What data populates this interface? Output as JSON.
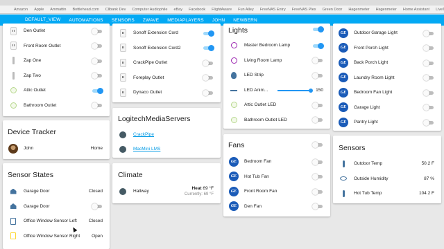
{
  "bookmarks": [
    "Amazon",
    "Apple",
    "Ammattin",
    "Bottlehead.com",
    "Cllbank Dev",
    "Computer Audiophile",
    "eBay",
    "Facebook",
    "FlightAware",
    "Fun Alley",
    "FreeNAS Entry",
    "FreeNAS Plex",
    "Green Door",
    "Hagenmeter",
    "Hagenmeter",
    "Home Assistant",
    "LiveTV Entry"
  ],
  "tabs": [
    "DEFAULT_VIEW",
    "AUTOMATIONS",
    "SENSORS",
    "ZWAVE",
    "MEDIAPLAYERS",
    "JOHN",
    "NEWBERN"
  ],
  "switches_card": {
    "items": [
      {
        "label": "Den Outlet",
        "icon": "outlet-icon",
        "on": false
      },
      {
        "label": "Front Room Outlet",
        "icon": "outlet-icon",
        "on": false
      },
      {
        "label": "Zap One",
        "icon": "plug-icon",
        "on": false
      },
      {
        "label": "Zap Two",
        "icon": "plug-icon",
        "on": false
      },
      {
        "label": "Attic Outlet",
        "icon": "light-icon",
        "on": true
      },
      {
        "label": "Bathroom Outlet",
        "icon": "light-icon",
        "on": false
      }
    ]
  },
  "device_tracker": {
    "title": "Device Tracker",
    "person": "John",
    "state": "Home"
  },
  "sensor_states": {
    "title": "Sensor States",
    "items": [
      {
        "label": "Garage Door",
        "value": "Closed",
        "icon": "garage-icon",
        "toggle": false
      },
      {
        "label": "Garage Door",
        "value": "",
        "icon": "garage-icon",
        "toggle": true
      },
      {
        "label": "Office Window Sensor Left",
        "value": "Closed",
        "icon": "window-icon",
        "toggle": false
      },
      {
        "label": "Office Window Sensor Right",
        "value": "Open",
        "icon": "window-icon",
        "toggle": false
      }
    ]
  },
  "outlets_card": {
    "items": [
      {
        "label": "Sonoff Extension Cord",
        "on": true
      },
      {
        "label": "Sonoff Extension Cord2",
        "on": true
      },
      {
        "label": "CrackPipe Outlet",
        "on": false
      },
      {
        "label": "Foreplay Outlet",
        "on": false
      },
      {
        "label": "Dynaco Outlet",
        "on": false
      }
    ]
  },
  "media_servers": {
    "title": "LogitechMediaServers",
    "items": [
      "CrackPipe",
      "MacMini LMS"
    ]
  },
  "climate": {
    "title": "Climate",
    "name": "Hallway",
    "mode": "Heat",
    "target": "69 °F",
    "current": "Currently: 69 °F"
  },
  "lights": {
    "title": "Lights",
    "items": [
      {
        "label": "Master Bedroom Lamp",
        "on": true
      },
      {
        "label": "Living Room Lamp",
        "on": false
      },
      {
        "label": "LED Strip",
        "on": false
      }
    ],
    "dimmer_label": "LED Anim...",
    "dimmer_value": "150",
    "outlets": [
      {
        "label": "Attic Outlet LED",
        "on": false
      },
      {
        "label": "Bathroom Outlet LED",
        "on": false
      }
    ]
  },
  "fans": {
    "title": "Fans",
    "items": [
      "Bedroom Fan",
      "Hot Tub Fan",
      "Front Room Fan",
      "Den Fan"
    ]
  },
  "ge_lights": {
    "items": [
      "Outdoor Garage Light",
      "Front Porch Light",
      "Back Porch Light",
      "Laundry Room Light",
      "Bedroom Fan Light",
      "Garage Light",
      "Pantry Light"
    ]
  },
  "sensors": {
    "title": "Sensors",
    "items": [
      {
        "label": "Outdoor Temp",
        "value": "50.2 F"
      },
      {
        "label": "Outside Humidity",
        "value": "87 %"
      },
      {
        "label": "Hot Tub Temp",
        "value": "104.2 F"
      }
    ]
  },
  "colors": {
    "accent": "#03a9f4",
    "toggle_on": "#2196f3",
    "ge_badge": "#1a5bb8"
  }
}
